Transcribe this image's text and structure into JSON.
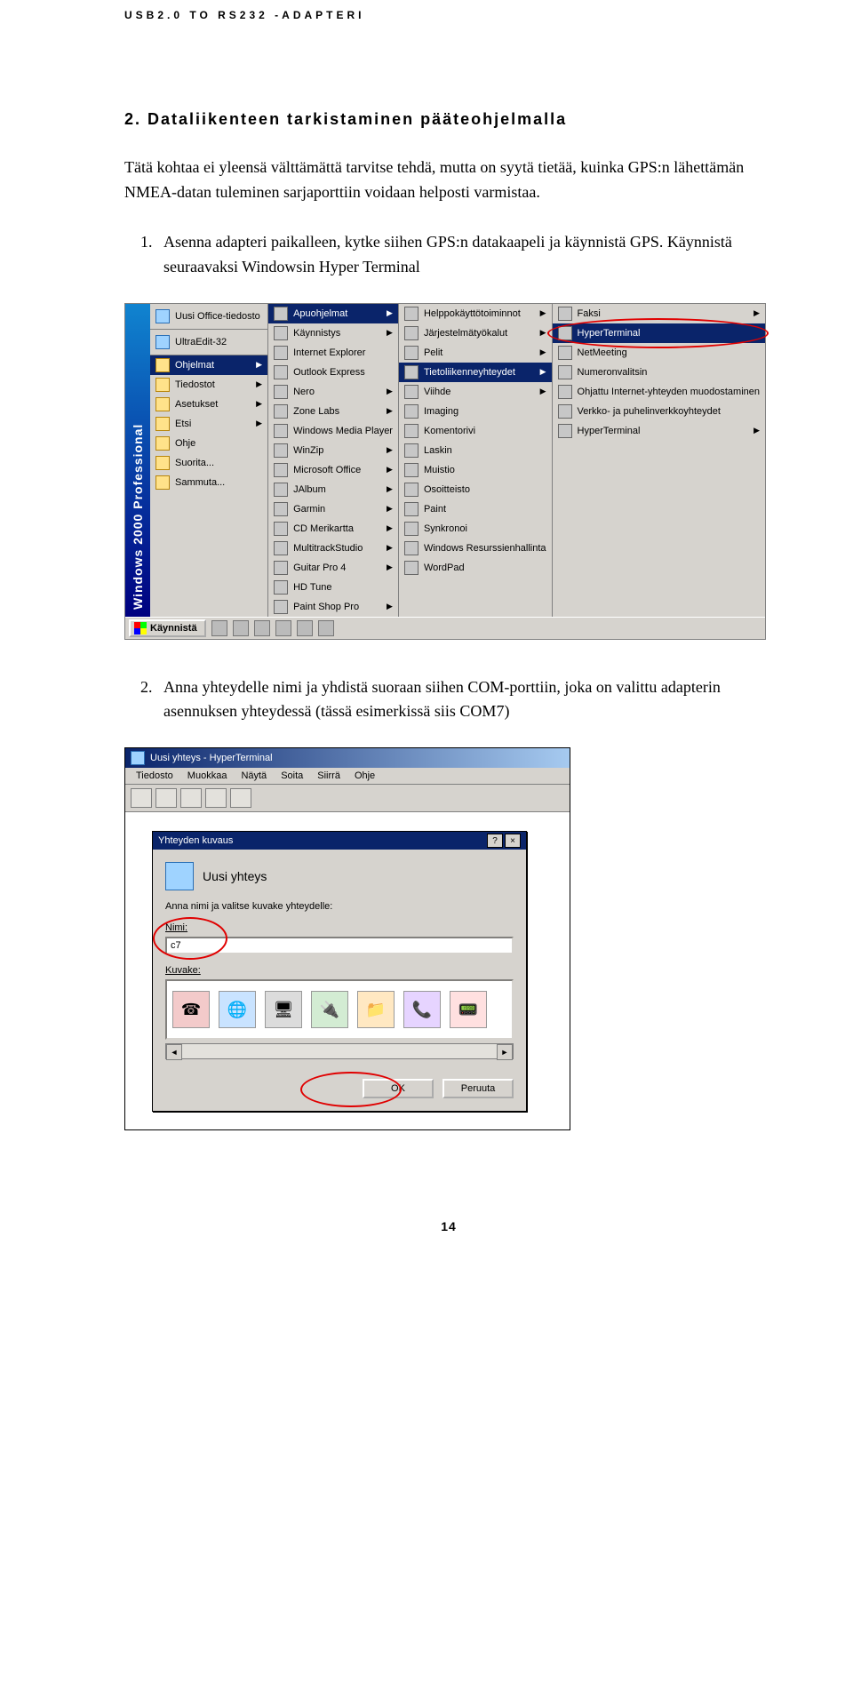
{
  "doc_header": "USB2.0 TO RS232 -ADAPTERI",
  "section_title": "2. Dataliikenteen tarkistaminen pääteohjelmalla",
  "lead_paragraph": "Tätä kohtaa ei yleensä välttämättä tarvitse tehdä, mutta on syytä tietää, kuinka GPS:n lähettämän NMEA-datan tuleminen sarjaporttiin voidaan helposti varmistaa.",
  "steps": [
    "Asenna adapteri paikalleen, kytke siihen GPS:n datakaapeli ja käynnistä GPS. Käynnistä seuraavaksi Windowsin Hyper Terminal",
    "Anna yhteydelle nimi ja yhdistä suoraan siihen COM-porttiin, joka on valittu adapterin asennuksen yhteydessä (tässä esimerkissä siis COM7)"
  ],
  "startmenu": {
    "strip": "Windows 2000 Professional",
    "top_items": [
      "Uusi Office-tiedosto",
      "UltraEdit-32"
    ],
    "col1": [
      {
        "label": "Ohjelmat",
        "arrow": true,
        "hl": true
      },
      {
        "label": "Tiedostot",
        "arrow": true
      },
      {
        "label": "Asetukset",
        "arrow": true
      },
      {
        "label": "Etsi",
        "arrow": true
      },
      {
        "label": "Ohje"
      },
      {
        "label": "Suorita..."
      },
      {
        "label": "Sammuta..."
      }
    ],
    "col2": [
      {
        "label": "Apuohjelmat",
        "arrow": true,
        "hl": true
      },
      {
        "label": "Käynnistys",
        "arrow": true
      },
      {
        "label": "Internet Explorer"
      },
      {
        "label": "Outlook Express"
      },
      {
        "label": "Nero",
        "arrow": true
      },
      {
        "label": "Zone Labs",
        "arrow": true
      },
      {
        "label": "Windows Media Player"
      },
      {
        "label": "WinZip",
        "arrow": true
      },
      {
        "label": "Microsoft Office",
        "arrow": true
      },
      {
        "label": "JAlbum",
        "arrow": true
      },
      {
        "label": "Garmin",
        "arrow": true
      },
      {
        "label": "CD Merikartta",
        "arrow": true
      },
      {
        "label": "MultitrackStudio",
        "arrow": true
      },
      {
        "label": "Guitar Pro 4",
        "arrow": true
      },
      {
        "label": "HD Tune"
      },
      {
        "label": "Paint Shop Pro",
        "arrow": true
      }
    ],
    "col3": [
      {
        "label": "Helppokäyttötoiminnot",
        "arrow": true
      },
      {
        "label": "Järjestelmätyökalut",
        "arrow": true
      },
      {
        "label": "Pelit",
        "arrow": true
      },
      {
        "label": "Tietoliikenneyhteydet",
        "arrow": true,
        "hl": true
      },
      {
        "label": "Viihde",
        "arrow": true
      },
      {
        "label": "Imaging"
      },
      {
        "label": "Komentorivi"
      },
      {
        "label": "Laskin"
      },
      {
        "label": "Muistio"
      },
      {
        "label": "Osoitteisto"
      },
      {
        "label": "Paint"
      },
      {
        "label": "Synkronoi"
      },
      {
        "label": "Windows Resurssienhallinta"
      },
      {
        "label": "WordPad"
      }
    ],
    "col4": [
      {
        "label": "Faksi",
        "arrow": true
      },
      {
        "label": "HyperTerminal",
        "hl": true,
        "circled": true
      },
      {
        "label": "NetMeeting"
      },
      {
        "label": "Numeronvalitsin"
      },
      {
        "label": "Ohjattu Internet-yhteyden muodostaminen"
      },
      {
        "label": "Verkko- ja puhelinverkkoyhteydet"
      },
      {
        "label": "HyperTerminal",
        "arrow": true
      }
    ],
    "taskbar_start": "Käynnistä"
  },
  "ht": {
    "title": "Uusi yhteys - HyperTerminal",
    "menubar": [
      "Tiedosto",
      "Muokkaa",
      "Näytä",
      "Soita",
      "Siirrä",
      "Ohje"
    ],
    "dialog_title": "Yhteyden kuvaus",
    "new_conn_label": "Uusi yhteys",
    "prompt": "Anna nimi ja valitse kuvake yhteydelle:",
    "name_label": "Nimi:",
    "name_value": "c7",
    "icon_label": "Kuvake:",
    "ok": "OK",
    "cancel": "Peruuta"
  },
  "page_number": "14"
}
